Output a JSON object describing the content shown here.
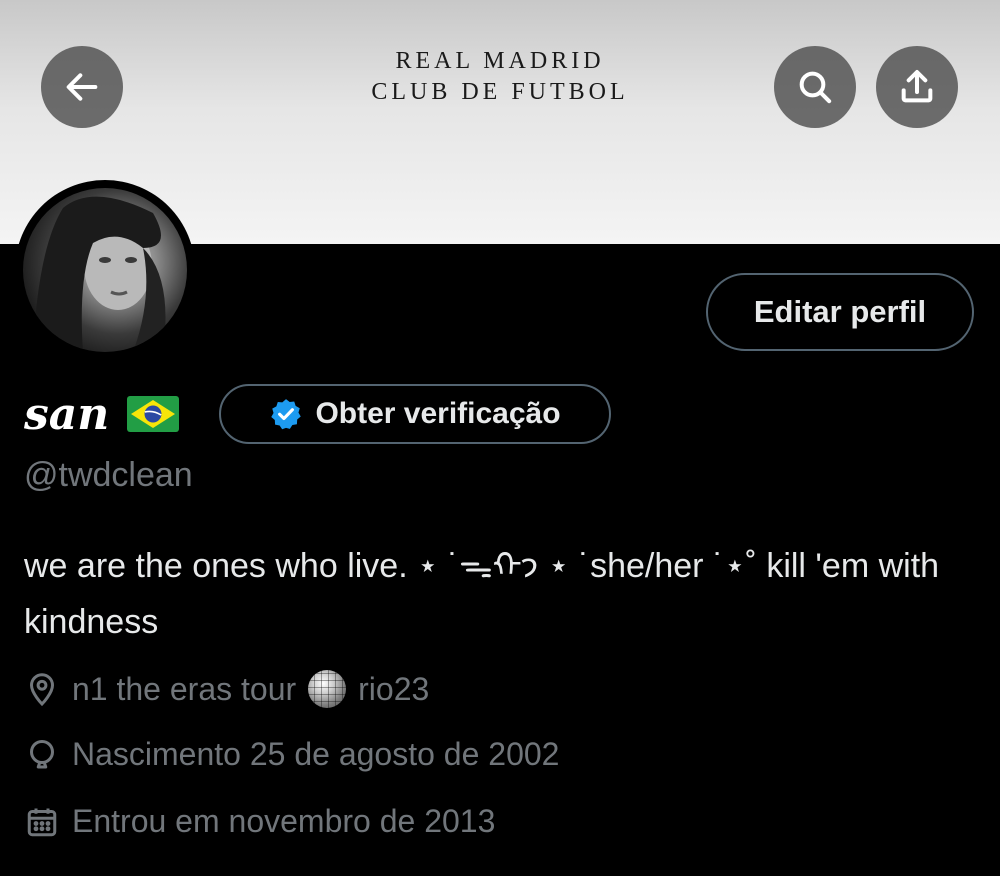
{
  "banner": {
    "line1": "REAL MADRID",
    "line2": "CLUB DE FUTBOL"
  },
  "header": {
    "back_icon": "arrow-left-icon",
    "search_icon": "search-icon",
    "share_icon": "share-upload-icon"
  },
  "profile": {
    "display_name": "san",
    "flag_icon": "brazil-flag-icon",
    "handle": "@twdclean",
    "edit_label": "Editar perfil",
    "verify_label": "Obter verificação",
    "bio": "we are the ones who live. ⋆ ˙ᯓᡣ𐭩 ⋆ ˙she/her ˙⋆˚ kill 'em with kindness",
    "location_part1": "n1 the eras tour",
    "location_part2": "rio23",
    "birth": "Nascimento 25 de agosto de 2002",
    "joined": "Entrou em novembro de 2013"
  },
  "colors": {
    "background": "#000000",
    "text": "#e7e9ea",
    "muted": "#71767b",
    "border": "#536471",
    "verified_blue": "#1d9bf0"
  }
}
